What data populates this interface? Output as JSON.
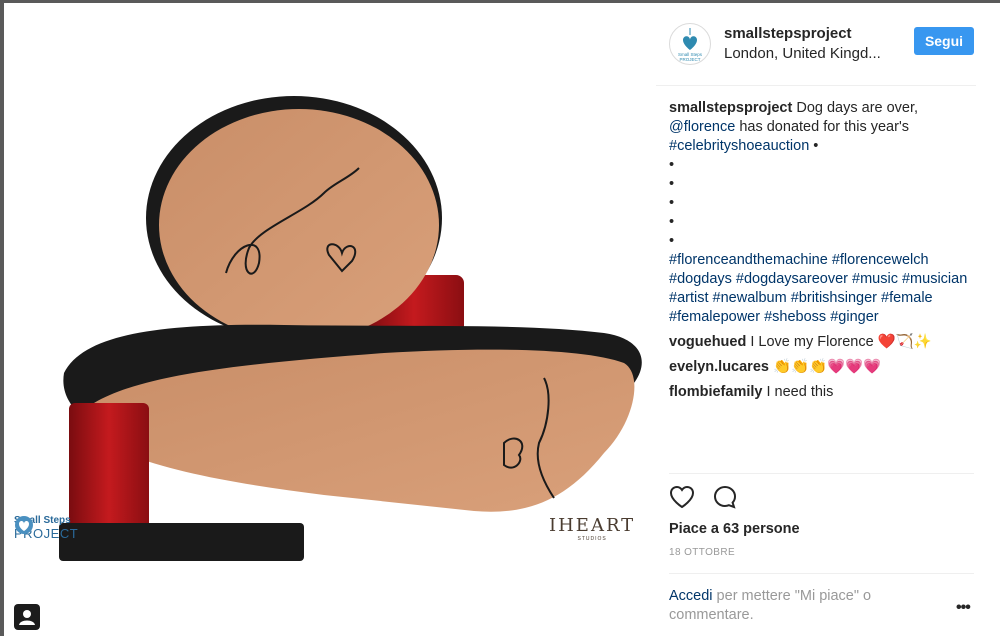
{
  "post": {
    "username": "smallstepsproject",
    "location": "London, United Kingd...",
    "follow_label": "Segui",
    "avatar_caption": "Small Steps PROJECT"
  },
  "image": {
    "watermark_left_line1": "Small Steps",
    "watermark_left_line2": "PROJECT",
    "watermark_right": "IHEART",
    "watermark_right_small": "STUDIOS"
  },
  "caption": {
    "username": "smallstepsproject",
    "text_1": " Dog days are over, ",
    "mention": "@florence",
    "text_2": " has donated for this year's ",
    "hashtag_main": "#celebrityshoeauction",
    "text_3": " •",
    "bullets": [
      "•",
      "•",
      "•",
      "•",
      "•"
    ],
    "hashtags": [
      "#florenceandthemachine",
      "#florencewelch",
      "#dogdays",
      "#dogdaysareover",
      "#music",
      "#musician",
      "#artist",
      "#newalbum",
      "#britishsinger",
      "#female",
      "#femalepower",
      "#sheboss",
      "#ginger"
    ]
  },
  "comments": [
    {
      "username": "voguehued",
      "text": " I Love my Florence ❤️🏹✨"
    },
    {
      "username": "evelyn.lucares",
      "text": " 👏👏👏💗💗💗"
    },
    {
      "username": "flombiefamily",
      "text": " I need this"
    }
  ],
  "likes": "Piace a 63 persone",
  "date": "18 OTTOBRE",
  "login": {
    "link": "Accedi",
    "text": " per mettere \"Mi piace\" o commentare."
  },
  "more_label": "•••",
  "icons": [
    "heart-icon",
    "comment-icon",
    "more-icon",
    "user-icon"
  ]
}
